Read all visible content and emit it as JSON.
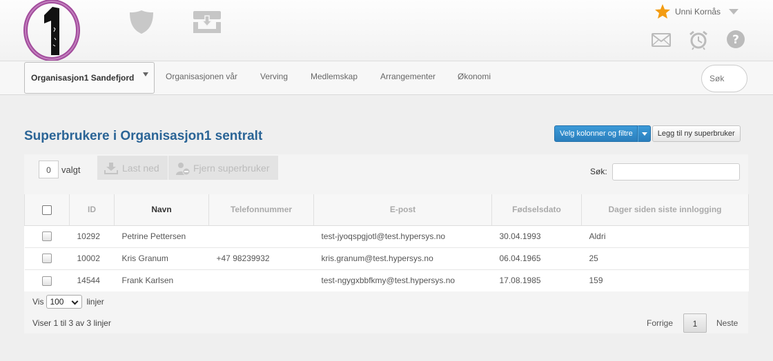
{
  "header": {
    "logo_text": "1",
    "user_name": "Unni Kornås",
    "icons": {
      "shield": "shield-icon",
      "download": "download-tray-icon",
      "mail": "mail-icon",
      "alarm": "alarm-clock-icon",
      "help": "help-icon",
      "star": "star-icon"
    }
  },
  "nav": {
    "org_select": "Organisasjon1 Sandefjord",
    "items": [
      "Organisasjonen vår",
      "Verving",
      "Medlemskap",
      "Arrangementer",
      "Økonomi"
    ],
    "search_placeholder": "Søk"
  },
  "page": {
    "title": "Superbrukere i Organisasjon1 sentralt",
    "choose_columns_button": "Velg kolonner og filtre",
    "add_button": "Legg til ny superbruker"
  },
  "toolbar": {
    "selected_count": "0",
    "selected_label": "valgt",
    "download_button": "Last ned",
    "remove_button": "Fjern superbruker",
    "search_label": "Søk:"
  },
  "table": {
    "columns": [
      "ID",
      "Navn",
      "Telefonnummer",
      "E-post",
      "Fødselsdato",
      "Dager siden siste innlogging"
    ],
    "rows": [
      {
        "id": "10292",
        "name": "Petrine Pettersen",
        "phone": "",
        "email": "test-jyoqspgjotl@test.hypersys.no",
        "birth": "30.04.1993",
        "days": "Aldri"
      },
      {
        "id": "10002",
        "name": "Kris Granum",
        "phone": "+47 98239932",
        "email": "kris.granum@test.hypersys.no",
        "birth": "06.04.1965",
        "days": "25"
      },
      {
        "id": "14544",
        "name": "Frank Karlsen",
        "phone": "",
        "email": "test-ngygxbbfkmy@test.hypersys.no",
        "birth": "17.08.1985",
        "days": "159"
      }
    ]
  },
  "footer": {
    "show_label": "Vis",
    "page_size": "100",
    "rows_label": "linjer",
    "showing_text": "Viser 1 til 3 av 3 linjer",
    "prev": "Forrige",
    "current_page": "1",
    "next": "Neste"
  },
  "colors": {
    "title": "#2a6496",
    "primary_button": "#2a8ac9",
    "star": "#f39c12",
    "logo_purple": "#a14a9b"
  }
}
